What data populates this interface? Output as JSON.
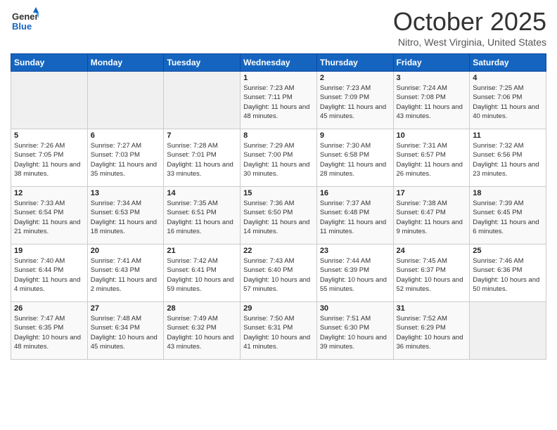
{
  "header": {
    "title": "October 2025",
    "location": "Nitro, West Virginia, United States"
  },
  "columns": [
    "Sunday",
    "Monday",
    "Tuesday",
    "Wednesday",
    "Thursday",
    "Friday",
    "Saturday"
  ],
  "weeks": [
    [
      {
        "day": "",
        "info": ""
      },
      {
        "day": "",
        "info": ""
      },
      {
        "day": "",
        "info": ""
      },
      {
        "day": "1",
        "info": "Sunrise: 7:23 AM\nSunset: 7:11 PM\nDaylight: 11 hours\nand 48 minutes."
      },
      {
        "day": "2",
        "info": "Sunrise: 7:23 AM\nSunset: 7:09 PM\nDaylight: 11 hours\nand 45 minutes."
      },
      {
        "day": "3",
        "info": "Sunrise: 7:24 AM\nSunset: 7:08 PM\nDaylight: 11 hours\nand 43 minutes."
      },
      {
        "day": "4",
        "info": "Sunrise: 7:25 AM\nSunset: 7:06 PM\nDaylight: 11 hours\nand 40 minutes."
      }
    ],
    [
      {
        "day": "5",
        "info": "Sunrise: 7:26 AM\nSunset: 7:05 PM\nDaylight: 11 hours\nand 38 minutes."
      },
      {
        "day": "6",
        "info": "Sunrise: 7:27 AM\nSunset: 7:03 PM\nDaylight: 11 hours\nand 35 minutes."
      },
      {
        "day": "7",
        "info": "Sunrise: 7:28 AM\nSunset: 7:01 PM\nDaylight: 11 hours\nand 33 minutes."
      },
      {
        "day": "8",
        "info": "Sunrise: 7:29 AM\nSunset: 7:00 PM\nDaylight: 11 hours\nand 30 minutes."
      },
      {
        "day": "9",
        "info": "Sunrise: 7:30 AM\nSunset: 6:58 PM\nDaylight: 11 hours\nand 28 minutes."
      },
      {
        "day": "10",
        "info": "Sunrise: 7:31 AM\nSunset: 6:57 PM\nDaylight: 11 hours\nand 26 minutes."
      },
      {
        "day": "11",
        "info": "Sunrise: 7:32 AM\nSunset: 6:56 PM\nDaylight: 11 hours\nand 23 minutes."
      }
    ],
    [
      {
        "day": "12",
        "info": "Sunrise: 7:33 AM\nSunset: 6:54 PM\nDaylight: 11 hours\nand 21 minutes."
      },
      {
        "day": "13",
        "info": "Sunrise: 7:34 AM\nSunset: 6:53 PM\nDaylight: 11 hours\nand 18 minutes."
      },
      {
        "day": "14",
        "info": "Sunrise: 7:35 AM\nSunset: 6:51 PM\nDaylight: 11 hours\nand 16 minutes."
      },
      {
        "day": "15",
        "info": "Sunrise: 7:36 AM\nSunset: 6:50 PM\nDaylight: 11 hours\nand 14 minutes."
      },
      {
        "day": "16",
        "info": "Sunrise: 7:37 AM\nSunset: 6:48 PM\nDaylight: 11 hours\nand 11 minutes."
      },
      {
        "day": "17",
        "info": "Sunrise: 7:38 AM\nSunset: 6:47 PM\nDaylight: 11 hours\nand 9 minutes."
      },
      {
        "day": "18",
        "info": "Sunrise: 7:39 AM\nSunset: 6:45 PM\nDaylight: 11 hours\nand 6 minutes."
      }
    ],
    [
      {
        "day": "19",
        "info": "Sunrise: 7:40 AM\nSunset: 6:44 PM\nDaylight: 11 hours\nand 4 minutes."
      },
      {
        "day": "20",
        "info": "Sunrise: 7:41 AM\nSunset: 6:43 PM\nDaylight: 11 hours\nand 2 minutes."
      },
      {
        "day": "21",
        "info": "Sunrise: 7:42 AM\nSunset: 6:41 PM\nDaylight: 10 hours\nand 59 minutes."
      },
      {
        "day": "22",
        "info": "Sunrise: 7:43 AM\nSunset: 6:40 PM\nDaylight: 10 hours\nand 57 minutes."
      },
      {
        "day": "23",
        "info": "Sunrise: 7:44 AM\nSunset: 6:39 PM\nDaylight: 10 hours\nand 55 minutes."
      },
      {
        "day": "24",
        "info": "Sunrise: 7:45 AM\nSunset: 6:37 PM\nDaylight: 10 hours\nand 52 minutes."
      },
      {
        "day": "25",
        "info": "Sunrise: 7:46 AM\nSunset: 6:36 PM\nDaylight: 10 hours\nand 50 minutes."
      }
    ],
    [
      {
        "day": "26",
        "info": "Sunrise: 7:47 AM\nSunset: 6:35 PM\nDaylight: 10 hours\nand 48 minutes."
      },
      {
        "day": "27",
        "info": "Sunrise: 7:48 AM\nSunset: 6:34 PM\nDaylight: 10 hours\nand 45 minutes."
      },
      {
        "day": "28",
        "info": "Sunrise: 7:49 AM\nSunset: 6:32 PM\nDaylight: 10 hours\nand 43 minutes."
      },
      {
        "day": "29",
        "info": "Sunrise: 7:50 AM\nSunset: 6:31 PM\nDaylight: 10 hours\nand 41 minutes."
      },
      {
        "day": "30",
        "info": "Sunrise: 7:51 AM\nSunset: 6:30 PM\nDaylight: 10 hours\nand 39 minutes."
      },
      {
        "day": "31",
        "info": "Sunrise: 7:52 AM\nSunset: 6:29 PM\nDaylight: 10 hours\nand 36 minutes."
      },
      {
        "day": "",
        "info": ""
      }
    ]
  ]
}
